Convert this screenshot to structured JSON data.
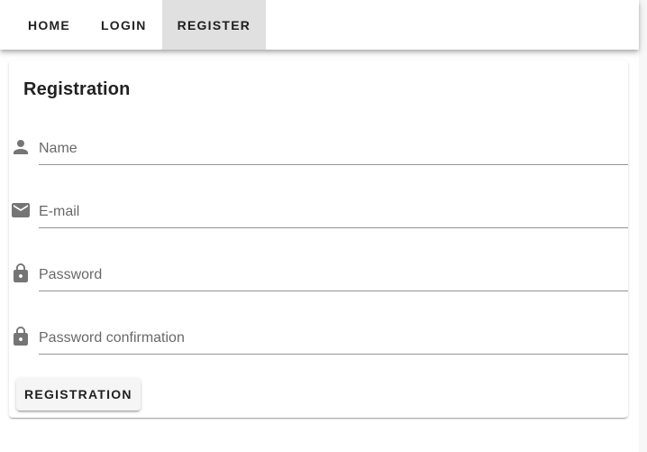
{
  "nav": {
    "items": [
      {
        "label": "HOME",
        "active": false
      },
      {
        "label": "LOGIN",
        "active": false
      },
      {
        "label": "REGISTER",
        "active": true
      }
    ]
  },
  "form": {
    "title": "Registration",
    "fields": [
      {
        "icon": "person-icon",
        "placeholder": "Name",
        "value": "",
        "type": "text"
      },
      {
        "icon": "mail-icon",
        "placeholder": "E-mail",
        "value": "",
        "type": "email"
      },
      {
        "icon": "lock-icon",
        "placeholder": "Password",
        "value": "",
        "type": "password"
      },
      {
        "icon": "lock-icon",
        "placeholder": "Password confirmation",
        "value": "",
        "type": "password"
      }
    ],
    "submit_label": "REGISTRATION"
  },
  "colors": {
    "active_tab_bg": "#e0e0e0",
    "icon": "#757575",
    "button_bg": "#f5f5f5"
  }
}
